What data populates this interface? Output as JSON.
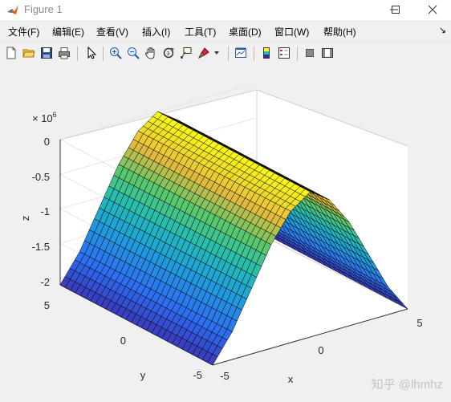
{
  "window": {
    "title": "Figure 1",
    "icon": "matlab-icon",
    "controls": [
      "minimize-icon",
      "maximize-icon",
      "close-icon"
    ]
  },
  "menubar": {
    "items": [
      {
        "label": "文件(F)"
      },
      {
        "label": "编辑(E)"
      },
      {
        "label": "查看(V)"
      },
      {
        "label": "插入(I)"
      },
      {
        "label": "工具(T)"
      },
      {
        "label": "桌面(D)"
      },
      {
        "label": "窗口(W)"
      },
      {
        "label": "帮助(H)"
      }
    ],
    "dock_arrow": "↘"
  },
  "toolbar": {
    "icons": [
      "new-figure-icon",
      "open-file-icon",
      "save-icon",
      "print-icon",
      "edit-plot-arrow-icon",
      "zoom-in-icon",
      "zoom-out-icon",
      "pan-hand-icon",
      "rotate-3d-icon",
      "data-cursor-icon",
      "brush-icon",
      "brush-dropdown-icon",
      "link-plot-icon",
      "insert-colorbar-icon",
      "insert-legend-icon",
      "hide-plot-tools-icon",
      "show-plot-tools-icon"
    ]
  },
  "plot": {
    "exponent_label": "× 10",
    "exponent_power": "6",
    "z_label": "z",
    "x_label": "x",
    "y_label": "y",
    "z_ticks": [
      "0",
      "-0.5",
      "-1",
      "-1.5",
      "-2"
    ],
    "x_ticks": [
      "-5",
      "0",
      "5"
    ],
    "y_ticks": [
      "-5",
      "0",
      "5"
    ],
    "colormap": "parula",
    "colors": {
      "low": "#3e26a8",
      "mid": "#21bcb6",
      "high": "#f9fb15",
      "edge": "#000000",
      "axes_background": "#ffffff",
      "figure_background": "#f0f0f0",
      "grid": "#e6e6e6"
    }
  },
  "chart_data": {
    "type": "surface",
    "title": "",
    "xlabel": "x",
    "ylabel": "y",
    "zlabel": "z",
    "xlim": [
      -5,
      5
    ],
    "ylim": [
      -5,
      5
    ],
    "zlim": [
      -2200000,
      0
    ],
    "z_scale_exponent": 6,
    "grid": true,
    "shape_note": "ridge: z peaks near 0 at x = 0 and falls to about -2.1e6 at x = ±5; nearly constant along y",
    "x": [
      -5,
      -4,
      -3,
      -2,
      -1,
      0,
      1,
      2,
      3,
      4,
      5
    ],
    "z_along_x": [
      -2100000,
      -1700000,
      -1150000,
      -600000,
      -200000,
      0,
      -200000,
      -600000,
      -1150000,
      -1700000,
      -2100000
    ]
  },
  "watermark": "知乎 @lhmhz"
}
